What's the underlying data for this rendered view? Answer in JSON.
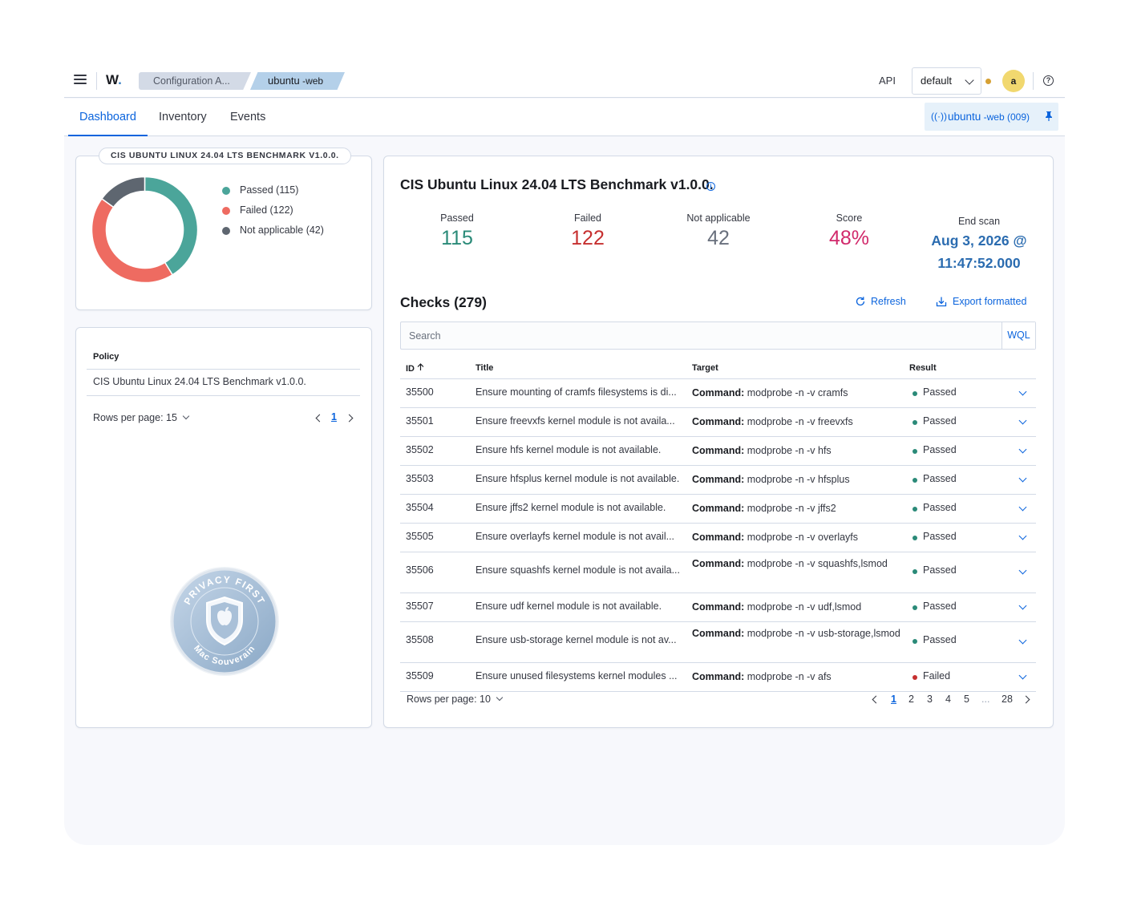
{
  "header": {
    "logo": "W",
    "breadcrumbs": [
      "Configuration A...",
      "ubuntu"
    ],
    "breadcrumb_suffix": " -web",
    "api_label": "API",
    "space": "default",
    "avatar_initial": "a",
    "help": "?"
  },
  "tabs": [
    {
      "label": "Dashboard",
      "active": true
    },
    {
      "label": "Inventory",
      "active": false
    },
    {
      "label": "Events",
      "active": false
    }
  ],
  "pinned_agent": {
    "name": "ubuntu",
    "suffix": " -web (009)"
  },
  "donut": {
    "title": "CIS UBUNTU LINUX 24.04 LTS BENCHMARK V1.0.0.",
    "legend": [
      {
        "label": "Passed (115)",
        "value": 115,
        "color": "#4ba59a"
      },
      {
        "label": "Failed (122)",
        "value": 122,
        "color": "#ee6b61"
      },
      {
        "label": "Not applicable (42)",
        "value": 42,
        "color": "#5e6670"
      }
    ]
  },
  "policy": {
    "column": "Policy",
    "value": "CIS Ubuntu Linux 24.04 LTS Benchmark v1.0.0.",
    "rows_per_page": "Rows per page: 15",
    "current_page": "1"
  },
  "seal": {
    "top_text": "PRIVACY FIRST",
    "bottom_text": "Mac Souverain"
  },
  "summary": {
    "title": "CIS Ubuntu Linux 24.04 LTS Benchmark v1.0.0.",
    "info": "i",
    "stats": [
      {
        "label": "Passed",
        "value": "115",
        "color": "#2a8a78"
      },
      {
        "label": "Failed",
        "value": "122",
        "color": "#c62f2f"
      },
      {
        "label": "Not applicable",
        "value": "42",
        "color": "#69707d"
      },
      {
        "label": "Score",
        "value": "48%",
        "color": "#d1296b"
      }
    ],
    "end_scan": {
      "label": "End scan",
      "line1": "Aug 3, 2026 @",
      "line2": "11:47:52.000"
    }
  },
  "checks": {
    "title": "Checks (279)",
    "refresh": "Refresh",
    "export": "Export formatted",
    "search_placeholder": "Search",
    "wql": "WQL",
    "columns": {
      "id": "ID",
      "title": "Title",
      "target": "Target",
      "result": "Result"
    },
    "command_label": "Command:",
    "rows": [
      {
        "id": "35500",
        "title": "Ensure mounting of cramfs filesystems is di...",
        "target": "modprobe -n -v cramfs",
        "result": "Passed"
      },
      {
        "id": "35501",
        "title": "Ensure freevxfs kernel module is not availa...",
        "target": "modprobe -n -v freevxfs",
        "result": "Passed"
      },
      {
        "id": "35502",
        "title": "Ensure hfs kernel module is not available.",
        "target": "modprobe -n -v hfs",
        "result": "Passed"
      },
      {
        "id": "35503",
        "title": "Ensure hfsplus kernel module is not available.",
        "target": "modprobe -n -v hfsplus",
        "result": "Passed"
      },
      {
        "id": "35504",
        "title": "Ensure jffs2 kernel module is not available.",
        "target": "modprobe -n -v jffs2",
        "result": "Passed"
      },
      {
        "id": "35505",
        "title": "Ensure overlayfs kernel module is not avail...",
        "target": "modprobe -n -v overlayfs",
        "result": "Passed"
      },
      {
        "id": "35506",
        "title": "Ensure squashfs kernel module is not availa...",
        "target": "modprobe -n -v squashfs,lsmod",
        "result": "Passed"
      },
      {
        "id": "35507",
        "title": "Ensure udf kernel module is not available.",
        "target": "modprobe -n -v udf,lsmod",
        "result": "Passed"
      },
      {
        "id": "35508",
        "title": "Ensure usb-storage kernel module is not av...",
        "target": "modprobe -n -v usb-storage,lsmod",
        "result": "Passed"
      },
      {
        "id": "35509",
        "title": "Ensure unused filesystems kernel modules ...",
        "target": "modprobe -n -v afs",
        "result": "Failed"
      }
    ],
    "rows_per_page": "Rows per page: 10",
    "pages": [
      "1",
      "2",
      "3",
      "4",
      "5",
      "...",
      "28"
    ],
    "result_colors": {
      "Passed": "#2a8a78",
      "Failed": "#c62f2f"
    }
  }
}
